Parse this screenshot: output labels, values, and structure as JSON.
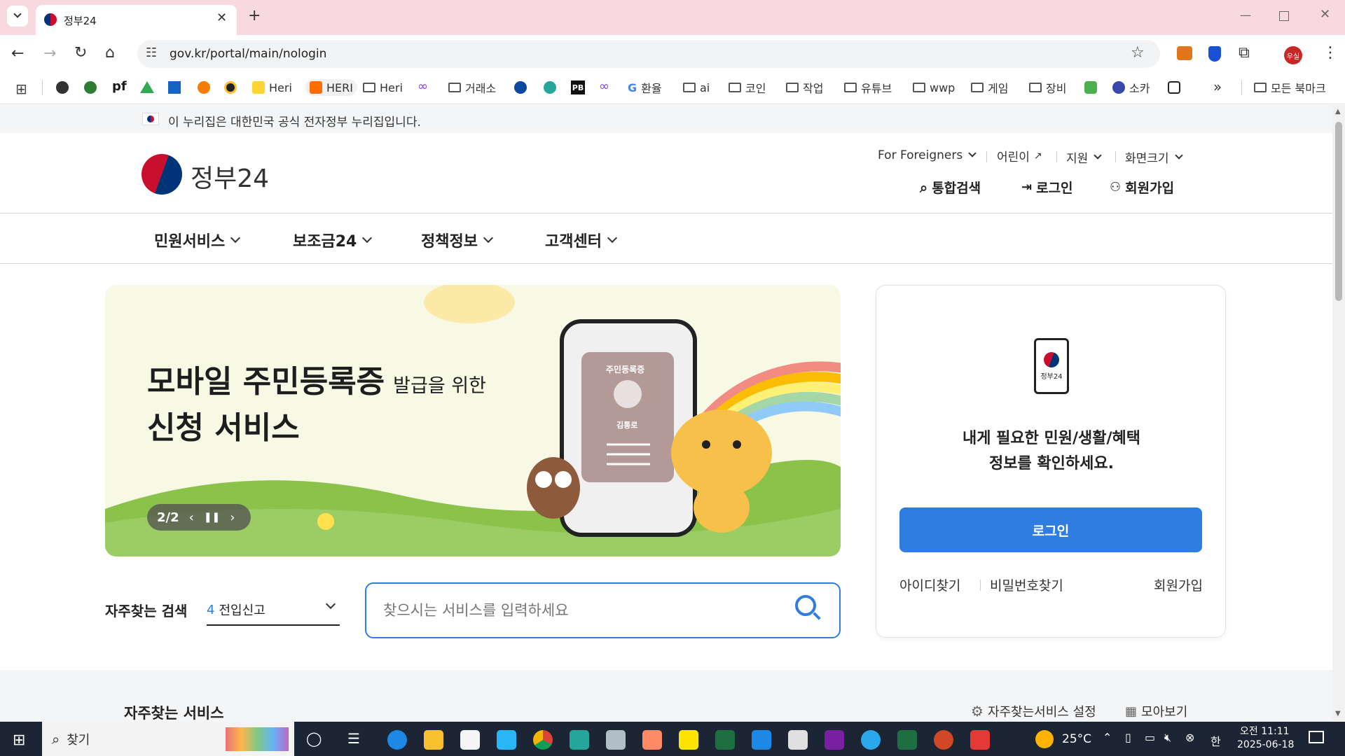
{
  "browser": {
    "tab_title": "정부24",
    "url": "gov.kr/portal/main/nologin",
    "profile_label": "우실",
    "bookmarks": [
      "Heri",
      "HERI",
      "Heri",
      "거래소",
      "환율",
      "ai",
      "코인",
      "작업",
      "유튜브",
      "wwp",
      "게임",
      "장비",
      "소카"
    ],
    "all_bookmarks": "모든 북마크"
  },
  "gov_notice": "이 누리집은 대한민국 공식 전자정부 누리집입니다.",
  "header": {
    "logo_text": "정부24",
    "util_links": [
      "For Foreigners",
      "어린이",
      "지원",
      "화면크기"
    ],
    "actions": {
      "search": "통합검색",
      "login": "로그인",
      "signup": "회원가입"
    }
  },
  "gnb": [
    "민원서비스",
    "보조금24",
    "정책정보",
    "고객센터"
  ],
  "banner": {
    "line1_big": "모바일 주민등록증",
    "line1_small": "발급을 위한",
    "line2": "신청 서비스",
    "card_title": "주민등록증",
    "card_name": "김통로",
    "counter": "2/2"
  },
  "search": {
    "label": "자주찾는 검색",
    "select_num": "4",
    "select_value": "전입신고",
    "placeholder": "찾으시는 서비스를 입력하세요"
  },
  "login_box": {
    "logo_text": "정부24",
    "message_line1": "내게 필요한 민원/생활/혜택",
    "message_line2": "정보를 확인하세요.",
    "login_button": "로그인",
    "find_id": "아이디찾기",
    "find_pw": "비밀번호찾기",
    "signup": "회원가입"
  },
  "services": {
    "title": "자주찾는 서비스",
    "settings": "자주찾는서비스 설정",
    "view_all": "모아보기"
  },
  "taskbar": {
    "search_label": "찾기",
    "weather": "25°C",
    "ime": "한",
    "time": "오전 11:11",
    "date": "2025-06-18"
  },
  "colors": {
    "accent": "#2f7de1",
    "tabbar": "#f7d9df",
    "taskbar": "#1c2533"
  }
}
